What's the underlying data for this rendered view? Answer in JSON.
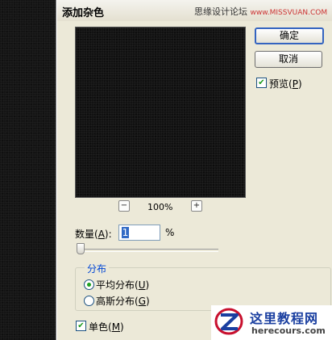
{
  "dialog": {
    "title": "添加杂色",
    "watermark_text": "思缘设计论坛",
    "watermark_url": "www.MISSVUAN.COM"
  },
  "preview": {
    "zoom_out": "−",
    "zoom_in": "+",
    "zoom_level": "100%"
  },
  "buttons": {
    "ok": "确定",
    "cancel": "取消"
  },
  "preview_checkbox": {
    "label_pre": "预览(",
    "key": "P",
    "label_post": ")",
    "checked": true
  },
  "amount": {
    "label_pre": "数量(",
    "key": "A",
    "label_post": "):",
    "value": "1",
    "unit": "%",
    "slider_fraction": 0.0
  },
  "distribution": {
    "title": "分布",
    "options": [
      {
        "label_pre": "平均分布(",
        "key": "U",
        "label_post": ")",
        "selected": true
      },
      {
        "label_pre": "高斯分布(",
        "key": "G",
        "label_post": ")",
        "selected": false
      }
    ]
  },
  "monochrome": {
    "label_pre": "单色(",
    "key": "M",
    "label_post": ")",
    "checked": true
  },
  "logo": {
    "cn_text": "这里教程网",
    "en_text": "herecours.com"
  },
  "colors": {
    "dialog_bg": "#ece9d8",
    "accent_blue": "#0046d5",
    "check_green": "#1a9a1a"
  }
}
